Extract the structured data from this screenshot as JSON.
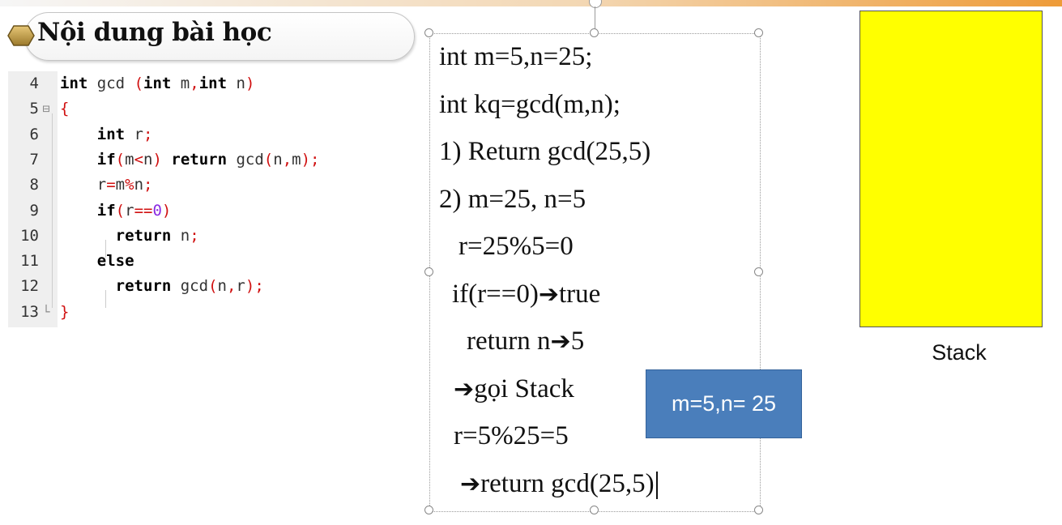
{
  "title": "Nội dung bài học",
  "code": {
    "lines": [
      {
        "num": "4",
        "fold": "",
        "code": "int gcd (int m,int n)"
      },
      {
        "num": "5",
        "fold": "⊟",
        "code": "{"
      },
      {
        "num": "6",
        "fold": "",
        "code": "    int r;"
      },
      {
        "num": "7",
        "fold": "",
        "code": "    if(m<n) return gcd(n,m);"
      },
      {
        "num": "8",
        "fold": "",
        "code": "    r=m%n;"
      },
      {
        "num": "9",
        "fold": "",
        "code": "    if(r==0)"
      },
      {
        "num": "10",
        "fold": "",
        "code": "      return n;"
      },
      {
        "num": "11",
        "fold": "",
        "code": "    else"
      },
      {
        "num": "12",
        "fold": "",
        "code": "      return gcd(n,r);"
      },
      {
        "num": "13",
        "fold": "└",
        "code": "}"
      }
    ]
  },
  "trace": {
    "l1": "int m=5,n=25;",
    "l2": "int kq=gcd(m,n);",
    "l3": "1) Return gcd(25,5)",
    "l4": "2) m=25, n=5",
    "l5": "r=25%5=0",
    "l6a": "if(r==0)",
    "l6b": "true",
    "l7a": "return n",
    "l7b": "5",
    "l8": "gọi Stack",
    "l9": "r=5%25=5",
    "l10": "return gcd(25,5)",
    "arrow": "➔"
  },
  "frame_label": "m=5,n= 25",
  "stack_label": "Stack",
  "colors": {
    "stack_fill": "#ffff00",
    "frame_fill": "#4a7ebb",
    "keyword": "#000000",
    "operator": "#d01010",
    "number": "#8a2be2"
  }
}
